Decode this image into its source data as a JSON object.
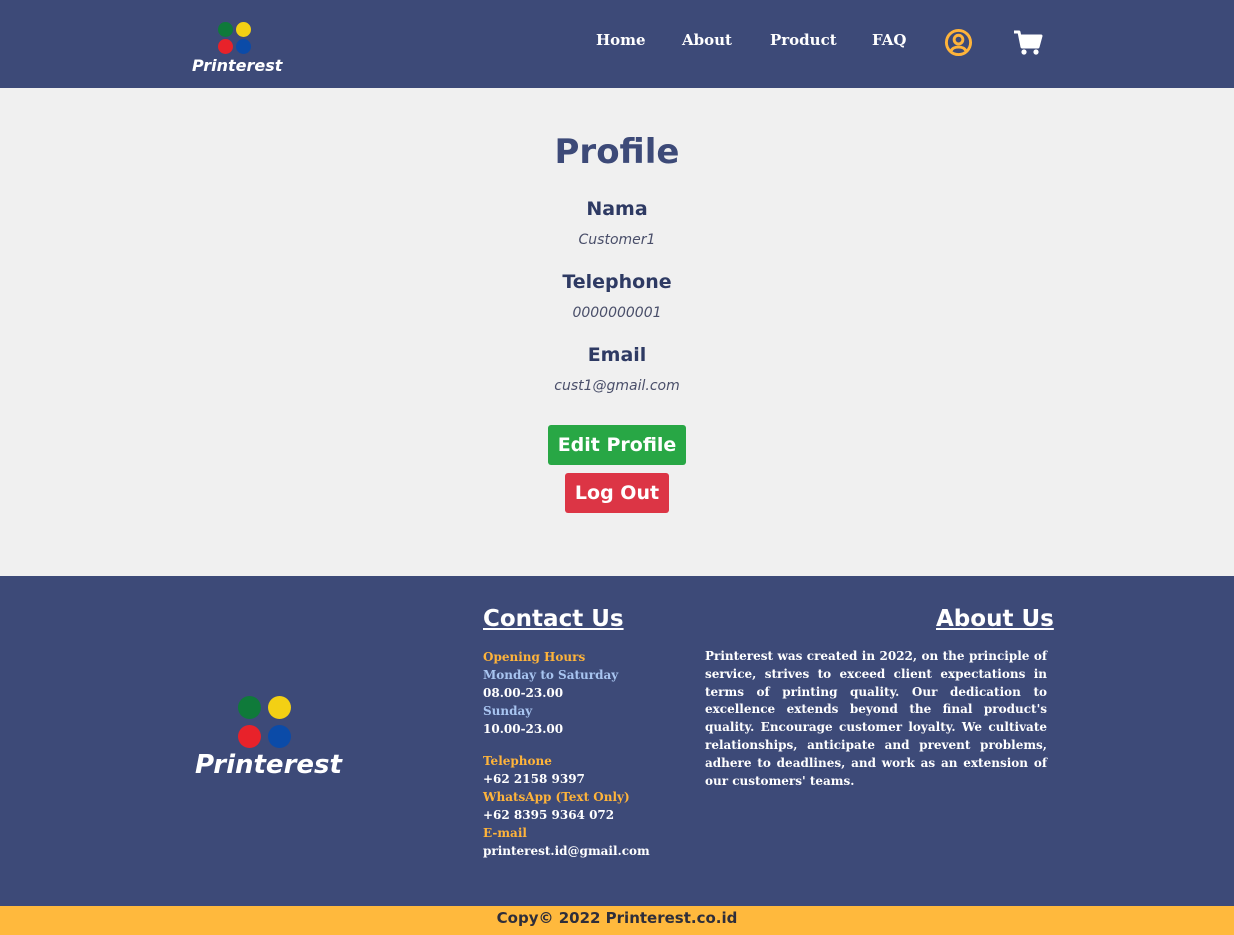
{
  "brand": {
    "name": "Printerest"
  },
  "colors": {
    "navy": "#3d4a78",
    "green": "#28a745",
    "red": "#dc3545",
    "gold": "#ffb93d",
    "logo_dots": [
      "#0f7a3a",
      "#f3d014",
      "#e8222a",
      "#0b4ba8"
    ]
  },
  "nav": {
    "items": [
      "Home",
      "About",
      "Product",
      "FAQ"
    ],
    "user_icon": "user-circle-icon",
    "cart_icon": "cart-icon"
  },
  "profile": {
    "title": "Profile",
    "name_label": "Nama",
    "name_value": "Customer1",
    "phone_label": "Telephone",
    "phone_value": "0000000001",
    "email_label": "Email",
    "email_value": "cust1@gmail.com",
    "edit_button": "Edit Profile",
    "logout_button": "Log Out"
  },
  "footer": {
    "contact_heading": "Contact Us",
    "opening_hours_label": "Opening Hours",
    "weekday_label": "Monday to Saturday",
    "weekday_hours": "08.00-23.00",
    "sunday_label": "Sunday",
    "sunday_hours": "10.00-23.00",
    "telephone_label": "Telephone",
    "telephone_value": "+62 2158 9397",
    "whatsapp_label": "WhatsApp (Text Only)",
    "whatsapp_value": "+62 8395 9364 072",
    "email_label": "E-mail",
    "email_value": "printerest.id@gmail.com",
    "about_heading": "About Us",
    "about_text": "Printerest was created in 2022, on the principle of service, strives to exceed client expectations in terms of printing quality. Our dedication to excellence extends beyond the final product's quality. Encourage customer loyalty. We cultivate relationships, anticipate and prevent problems, adhere to deadlines, and work as an extension of our customers' teams."
  },
  "copyright": "Copy© 2022 Printerest.co.id"
}
